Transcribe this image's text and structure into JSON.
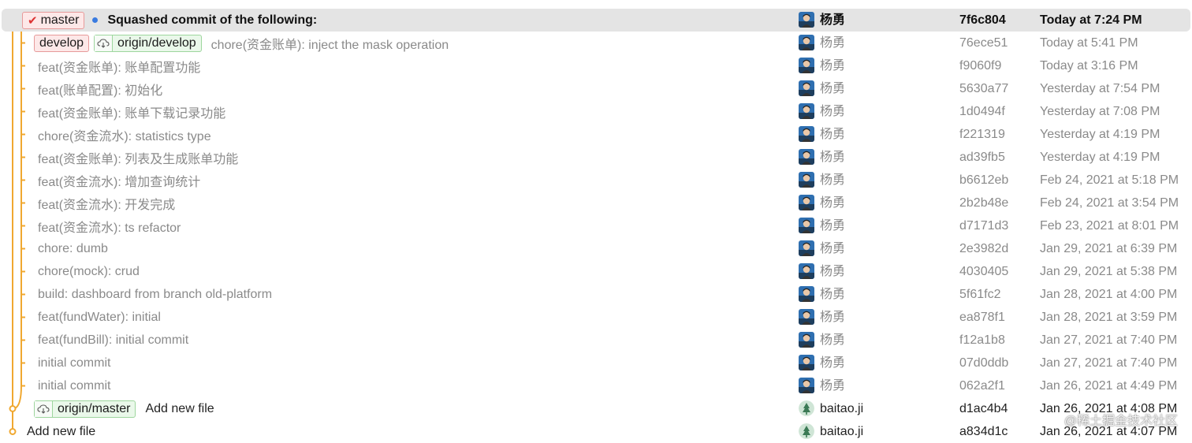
{
  "colors": {
    "graph_line": "#f0a830",
    "selected_bg": "#e4e4e4",
    "head_dot": "#3a7be0"
  },
  "commits": [
    {
      "tags": [
        {
          "type": "local",
          "icon": "check-icon",
          "label": "master"
        }
      ],
      "head": true,
      "message": "Squashed commit of the following:",
      "author": "杨勇",
      "avatar": "photo-avatar",
      "sha": "7f6c804",
      "date": "Today at 7:24 PM",
      "selected": true
    },
    {
      "tags": [
        {
          "type": "local",
          "label": "develop"
        },
        {
          "type": "remote",
          "icon": "cloud-icon",
          "label": "origin/develop"
        }
      ],
      "message": "chore(资金账单): inject the mask operation",
      "author": "杨勇",
      "avatar": "photo-avatar",
      "sha": "76ece51",
      "date": "Today at 5:41 PM"
    },
    {
      "message": "feat(资金账单): 账单配置功能",
      "author": "杨勇",
      "avatar": "photo-avatar",
      "sha": "f9060f9",
      "date": "Today at 3:16 PM"
    },
    {
      "message": "feat(账单配置): 初始化",
      "author": "杨勇",
      "avatar": "photo-avatar",
      "sha": "5630a77",
      "date": "Yesterday at 7:54 PM"
    },
    {
      "message": "feat(资金账单): 账单下载记录功能",
      "author": "杨勇",
      "avatar": "photo-avatar",
      "sha": "1d0494f",
      "date": "Yesterday at 7:08 PM"
    },
    {
      "message": "chore(资金流水): statistics type",
      "author": "杨勇",
      "avatar": "photo-avatar",
      "sha": "f221319",
      "date": "Yesterday at 4:19 PM"
    },
    {
      "message": "feat(资金账单): 列表及生成账单功能",
      "author": "杨勇",
      "avatar": "photo-avatar",
      "sha": "ad39fb5",
      "date": "Yesterday at 4:19 PM"
    },
    {
      "message": "feat(资金流水): 增加查询统计",
      "author": "杨勇",
      "avatar": "photo-avatar",
      "sha": "b6612eb",
      "date": "Feb 24, 2021 at 5:18 PM"
    },
    {
      "message": "feat(资金流水): 开发完成",
      "author": "杨勇",
      "avatar": "photo-avatar",
      "sha": "2b2b48e",
      "date": "Feb 24, 2021 at 3:54 PM"
    },
    {
      "message": "feat(资金流水): ts refactor",
      "author": "杨勇",
      "avatar": "photo-avatar",
      "sha": "d7171d3",
      "date": "Feb 23, 2021 at 8:01 PM"
    },
    {
      "message": "chore: dumb",
      "author": "杨勇",
      "avatar": "photo-avatar",
      "sha": "2e3982d",
      "date": "Jan 29, 2021 at 6:39 PM"
    },
    {
      "message": "chore(mock): crud",
      "author": "杨勇",
      "avatar": "photo-avatar",
      "sha": "4030405",
      "date": "Jan 29, 2021 at 5:38 PM"
    },
    {
      "message": "build: dashboard from branch old-platform",
      "author": "杨勇",
      "avatar": "photo-avatar",
      "sha": "5f61fc2",
      "date": "Jan 28, 2021 at 4:00 PM"
    },
    {
      "message": "feat(fundWater): initial",
      "author": "杨勇",
      "avatar": "photo-avatar",
      "sha": "ea878f1",
      "date": "Jan 28, 2021 at 3:59 PM"
    },
    {
      "message": "feat(fundBill): initial commit",
      "author": "杨勇",
      "avatar": "photo-avatar",
      "sha": "f12a1b8",
      "date": "Jan 27, 2021 at 7:40 PM"
    },
    {
      "message": "initial commit",
      "author": "杨勇",
      "avatar": "photo-avatar",
      "sha": "07d0ddb",
      "date": "Jan 27, 2021 at 7:40 PM"
    },
    {
      "message": "initial commit",
      "author": "杨勇",
      "avatar": "photo-avatar",
      "sha": "062a2f1",
      "date": "Jan 26, 2021 at 4:49 PM"
    },
    {
      "tags": [
        {
          "type": "remote",
          "icon": "cloud-icon",
          "label": "origin/master"
        }
      ],
      "message": "Add new file",
      "author": "baitao.ji",
      "avatar": "round-avatar",
      "sha": "d1ac4b4",
      "date": "Jan 26, 2021 at 4:08 PM",
      "dark": true
    },
    {
      "message": "Add new file",
      "author": "baitao.ji",
      "avatar": "round-avatar",
      "sha": "a834d1c",
      "date": "Jan 26, 2021 at 4:07 PM",
      "dark": true
    }
  ],
  "watermark": "@稀土掘金技术社区"
}
